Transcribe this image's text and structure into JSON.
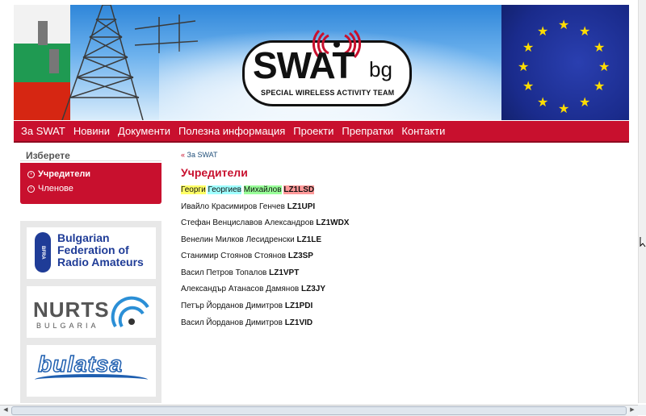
{
  "banner": {
    "logo_main": "SWAT",
    "logo_suffix": "bg",
    "logo_subtitle": "SPECIAL WIRELESS ACTIVITY TEAM"
  },
  "nav": {
    "items": [
      "За SWAT",
      "Новини",
      "Документи",
      "Полезна информация",
      "Проекти",
      "Препратки",
      "Контакти"
    ]
  },
  "sidebar": {
    "title": "Изберете",
    "items": [
      {
        "label": "Учредители",
        "active": true
      },
      {
        "label": "Членове",
        "active": false
      }
    ],
    "partners": {
      "bfra": {
        "seal": "BFRA",
        "line1": "Bulgarian",
        "line2": "Federation of",
        "line3": "Radio Amateurs"
      },
      "nurts": {
        "name": "NURTS",
        "sub": "BULGARIA"
      },
      "bulatsa": {
        "name": "bulatsa"
      }
    }
  },
  "main": {
    "breadcrumb_prefix": "«",
    "breadcrumb": "За SWAT",
    "title": "Учредители",
    "first_row": {
      "parts": [
        "Георги",
        "Георгиев",
        "Михайлов",
        "LZ1LSD"
      ]
    },
    "founders": [
      {
        "name": "Ивайло Красимиров Генчев",
        "call": "LZ1UPI"
      },
      {
        "name": "Стефан Венциславов Александров",
        "call": "LZ1WDX"
      },
      {
        "name": "Венелин Милков Лесидренски",
        "call": "LZ1LE"
      },
      {
        "name": "Станимир Стоянов Стоянов",
        "call": "LZ3SP"
      },
      {
        "name": "Васил Петров Топалов",
        "call": "LZ1VPT"
      },
      {
        "name": "Александър Атанасов Дамянов",
        "call": "LZ3JY"
      },
      {
        "name": "Петър Йорданов Димитров",
        "call": "LZ1PDI"
      },
      {
        "name": "Васил Йорданов Димитров",
        "call": "LZ1VID"
      }
    ]
  },
  "colors": {
    "brand_red": "#c8102e",
    "eu_blue": "#1a2b8c",
    "eu_star": "#ffdd00"
  }
}
